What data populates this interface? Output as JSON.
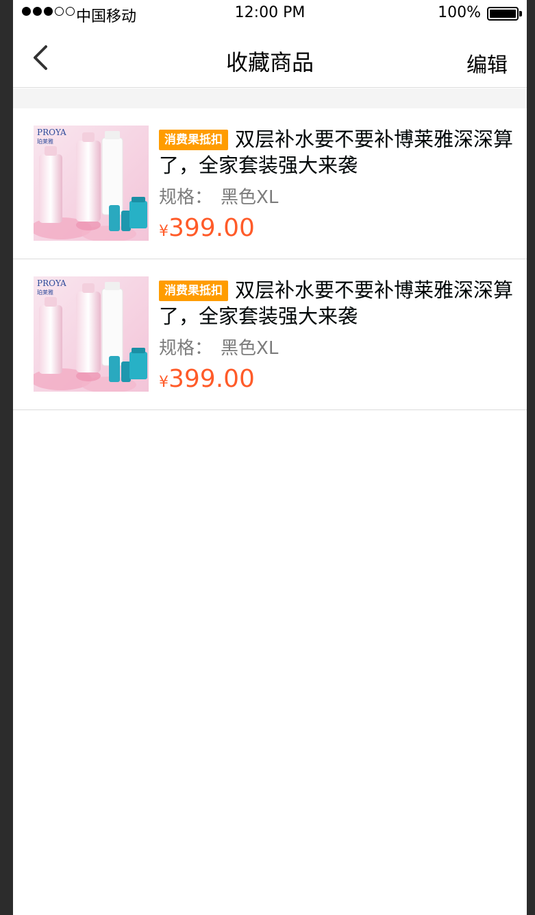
{
  "status_bar": {
    "carrier": "中国移动",
    "time": "12:00 PM",
    "battery": "100%",
    "signal_strength": 3
  },
  "nav": {
    "title": "收藏商品",
    "edit_label": "编辑",
    "back_icon": "chevron-left-icon"
  },
  "colors": {
    "tag_bg": "#ff9c00",
    "tag_text": "#ffffff",
    "title_text": "#000607",
    "spec_text": "#7c7c7c",
    "price": "#ff5b29",
    "divider": "#dcdcdc"
  },
  "products": [
    {
      "tag": "消费果抵扣",
      "title": "双层补水要不要补博莱雅深深算了，全家套装强大来袭",
      "spec_label": "规格：",
      "spec_value": "黑色XL",
      "currency": "¥",
      "price": "399.00",
      "image_brand": "PROYA",
      "image_brand_cn": "珀莱雅"
    },
    {
      "tag": "消费果抵扣",
      "title": "双层补水要不要补博莱雅深深算了，全家套装强大来袭",
      "spec_label": "规格：",
      "spec_value": "黑色XL",
      "currency": "¥",
      "price": "399.00",
      "image_brand": "PROYA",
      "image_brand_cn": "珀莱雅"
    }
  ]
}
